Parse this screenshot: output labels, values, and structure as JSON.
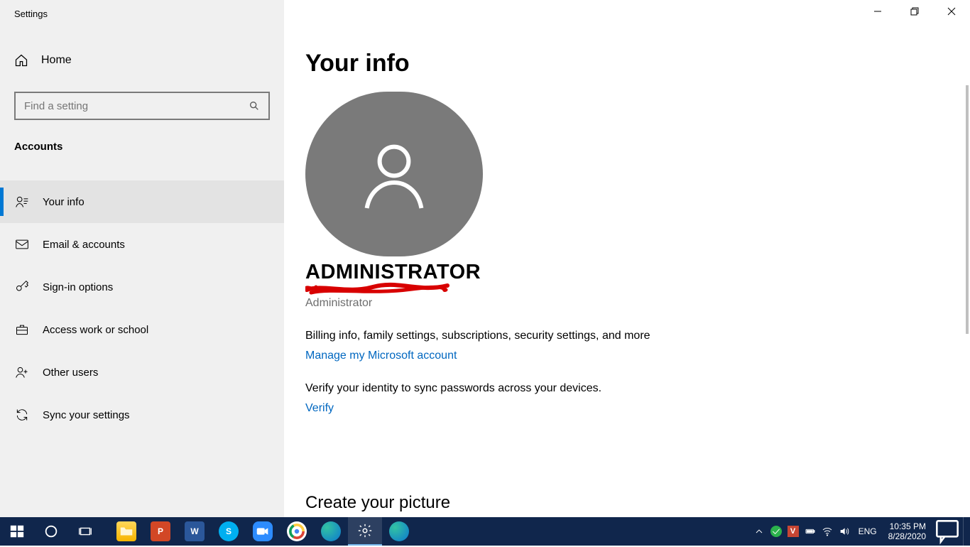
{
  "window": {
    "title": "Settings",
    "controls": {
      "minimize": "Minimize",
      "maximize": "Restore",
      "close": "Close"
    }
  },
  "sidebar": {
    "home": "Home",
    "search_placeholder": "Find a setting",
    "category": "Accounts",
    "items": [
      {
        "label": "Your info"
      },
      {
        "label": "Email & accounts"
      },
      {
        "label": "Sign-in options"
      },
      {
        "label": "Access work or school"
      },
      {
        "label": "Other users"
      },
      {
        "label": "Sync your settings"
      }
    ]
  },
  "content": {
    "heading": "Your info",
    "user_name": "ADMINISTRATOR",
    "user_role": "Administrator",
    "billing_blurb": "Billing info, family settings, subscriptions, security settings, and more",
    "manage_link": "Manage my Microsoft account",
    "verify_blurb": "Verify your identity to sync passwords across your devices.",
    "verify_link": "Verify",
    "picture_heading": "Create your picture"
  },
  "taskbar": {
    "lang": "ENG",
    "time": "10:35 PM",
    "date": "8/28/2020"
  }
}
